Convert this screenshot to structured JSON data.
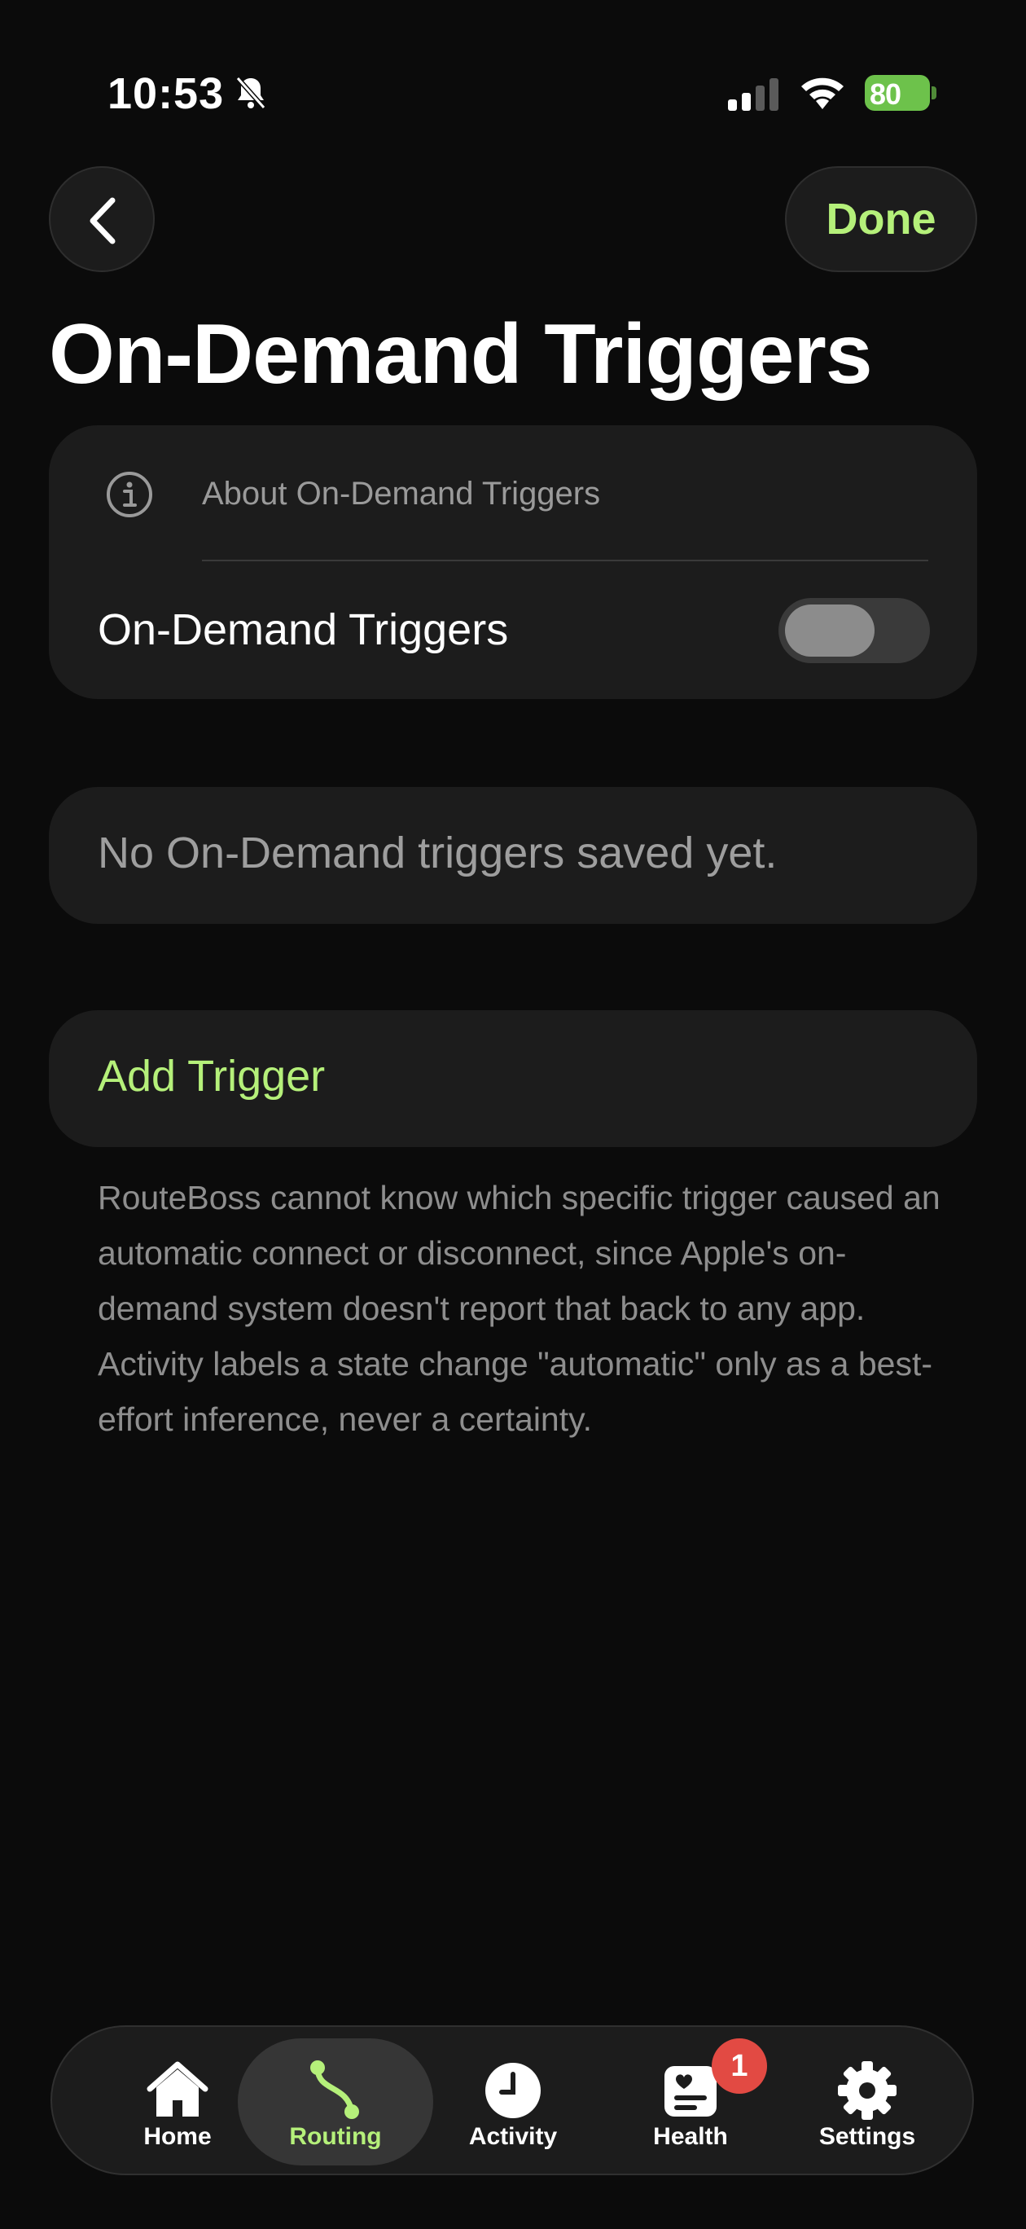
{
  "status_bar": {
    "time": "10:53",
    "battery_percent": "80",
    "icons": [
      "bell-slash-icon",
      "cellular-signal-icon",
      "wifi-icon",
      "battery-charging-icon"
    ]
  },
  "nav": {
    "back_icon": "chevron-left-icon",
    "done_label": "Done"
  },
  "page_title": "On-Demand Triggers",
  "settings_card": {
    "about_label": "About On-Demand Triggers",
    "toggle_label": "On-Demand Triggers",
    "toggle_on": false
  },
  "empty_state": "No On-Demand triggers saved yet.",
  "add_trigger_label": "Add Trigger",
  "footnote": "RouteBoss cannot know which specific trigger caused an automatic connect or disconnect, since Apple's on-demand system doesn't report that back to any app. Activity labels a state change \"automatic\" only as a best-effort inference, never a certainty.",
  "tabbar": {
    "tabs": [
      {
        "label": "Home",
        "icon": "home-icon"
      },
      {
        "label": "Routing",
        "icon": "routing-icon",
        "active": true
      },
      {
        "label": "Activity",
        "icon": "clock-icon"
      },
      {
        "label": "Health",
        "icon": "health-icon",
        "badge": "1"
      },
      {
        "label": "Settings",
        "icon": "gear-icon"
      }
    ]
  },
  "colors": {
    "accent": "#b5f07a",
    "background": "#0b0b0b",
    "card": "#1c1c1c",
    "badge": "#e24a43",
    "battery": "#6dc24b"
  }
}
